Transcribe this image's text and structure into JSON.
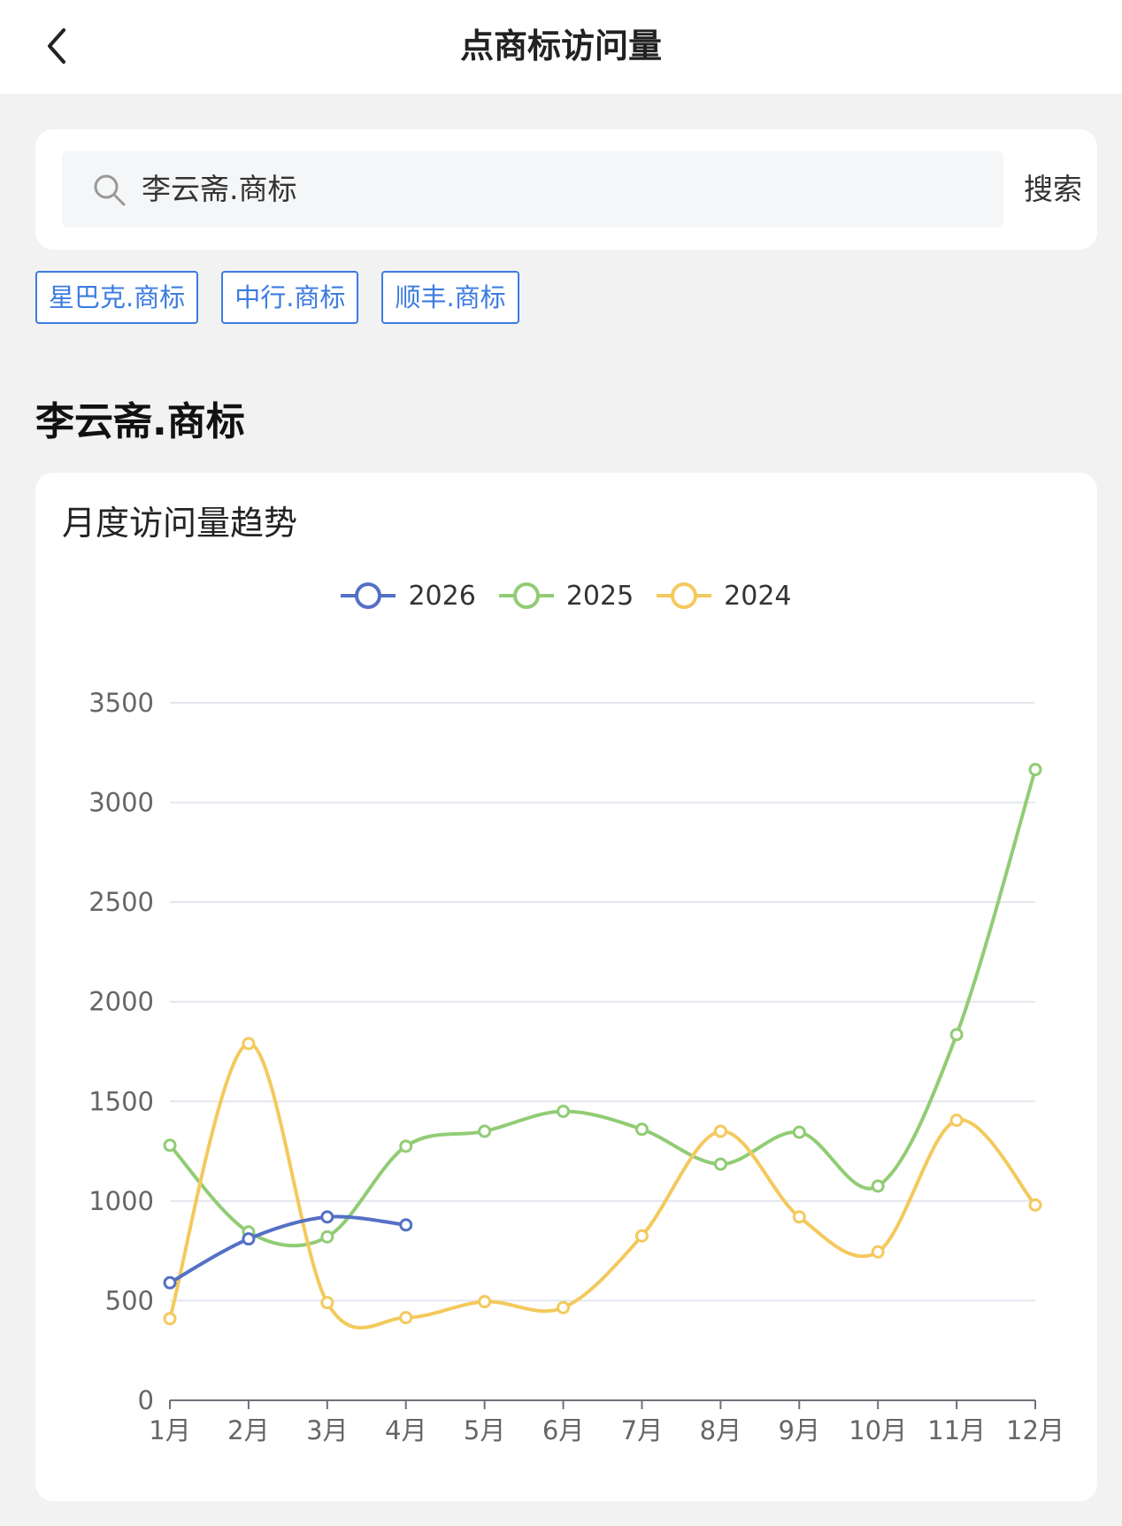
{
  "header": {
    "title": "点商标访问量"
  },
  "search": {
    "value": "李云斋.商标",
    "button": "搜索"
  },
  "quick_tags": [
    "星巴克.商标",
    "中行.商标",
    "顺丰.商标"
  ],
  "section": {
    "title": "李云斋.商标"
  },
  "colors": {
    "accent": "#3c7ce0",
    "s2026": "#5470c6",
    "s2025": "#91cc75",
    "s2024": "#f4c95d"
  },
  "chart_data": {
    "type": "line",
    "title": "月度访问量趋势",
    "categories": [
      "1月",
      "2月",
      "3月",
      "4月",
      "5月",
      "6月",
      "7月",
      "8月",
      "9月",
      "10月",
      "11月",
      "12月"
    ],
    "ylim": [
      0,
      3500
    ],
    "yticks": [
      "0",
      "500",
      "1000",
      "1500",
      "2000",
      "2500",
      "3000",
      "3500"
    ],
    "legend_position": "top-center",
    "grid": true,
    "smooth": true,
    "series": [
      {
        "name": "2026",
        "color": "#5470c6",
        "values": [
          590,
          810,
          920,
          880
        ]
      },
      {
        "name": "2025",
        "color": "#91cc75",
        "values": [
          1280,
          845,
          820,
          1275,
          1350,
          1450,
          1360,
          1185,
          1345,
          1075,
          1835,
          3165
        ]
      },
      {
        "name": "2024",
        "color": "#f4c95d",
        "values": [
          410,
          1790,
          490,
          415,
          495,
          465,
          825,
          1350,
          920,
          745,
          1405,
          980
        ]
      }
    ]
  }
}
